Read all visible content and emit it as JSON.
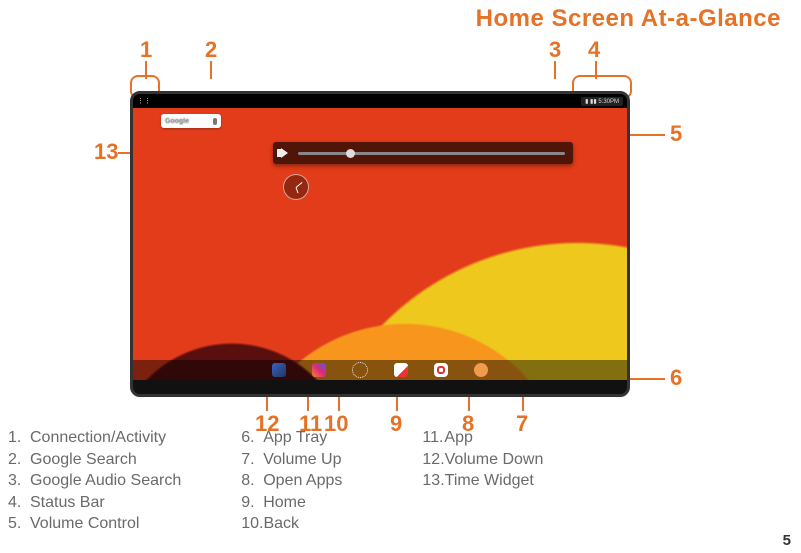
{
  "title": "Home Screen At-a-Glance",
  "page_number": "5",
  "status_left": "⋮⋮",
  "status_right": "▮ ▮▮ 5:30PM",
  "search_text": "Google",
  "callouts": {
    "c1": "1",
    "c2": "2",
    "c3": "3",
    "c4": "4",
    "c5": "5",
    "c6": "6",
    "c7": "7",
    "c8": "8",
    "c9": "9",
    "c10": "10",
    "c11": "11",
    "c12": "12",
    "c13": "13"
  },
  "legend": {
    "col1": [
      {
        "n": "1.",
        "t": "Connection/Activity"
      },
      {
        "n": "2.",
        "t": "Google Search"
      },
      {
        "n": "3.",
        "t": "Google Audio Search"
      },
      {
        "n": "4.",
        "t": "Status Bar"
      },
      {
        "n": "5.",
        "t": "Volume Control"
      }
    ],
    "col2": [
      {
        "n": "6.",
        "t": "App Tray"
      },
      {
        "n": "7.",
        "t": "Volume Up"
      },
      {
        "n": "8.",
        "t": "Open Apps"
      },
      {
        "n": "9.",
        "t": "Home"
      },
      {
        "n": "10.",
        "t": "Back"
      }
    ],
    "col3": [
      {
        "n": "11.",
        "t": "App"
      },
      {
        "n": "12.",
        "t": "Volume Down"
      },
      {
        "n": "13.",
        "t": "Time Widget"
      }
    ]
  }
}
